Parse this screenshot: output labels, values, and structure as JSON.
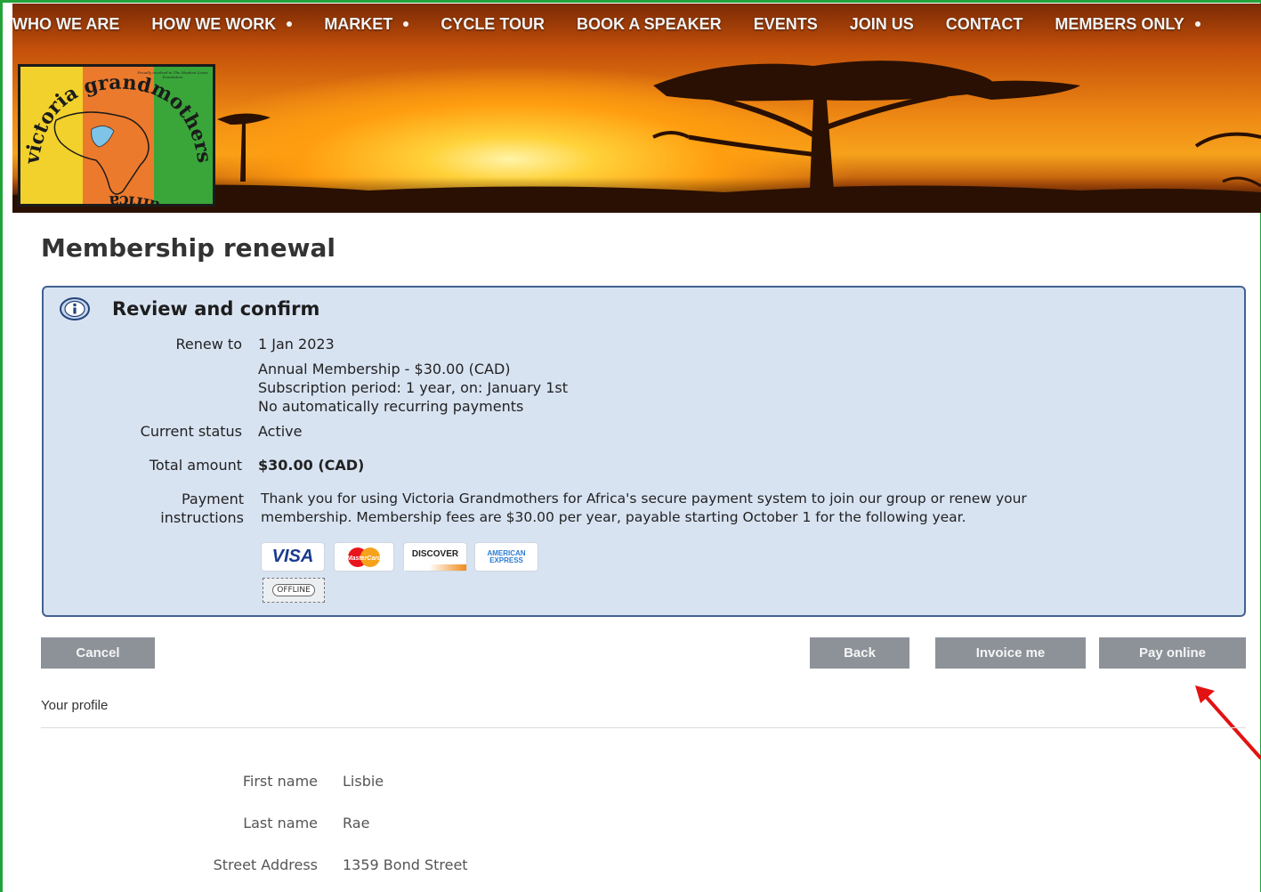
{
  "nav": {
    "items": [
      {
        "label": "WHO WE ARE",
        "dropdown": false
      },
      {
        "label": "HOW WE WORK",
        "dropdown": true
      },
      {
        "label": "MARKET",
        "dropdown": true
      },
      {
        "label": "CYCLE TOUR",
        "dropdown": false
      },
      {
        "label": "BOOK A SPEAKER",
        "dropdown": false
      },
      {
        "label": "EVENTS",
        "dropdown": false
      },
      {
        "label": "JOIN US",
        "dropdown": false
      },
      {
        "label": "CONTACT",
        "dropdown": false
      },
      {
        "label": "MEMBERS ONLY",
        "dropdown": true
      }
    ]
  },
  "logo": {
    "text_top": "victoria grandmothers",
    "text_bottom": "for africa",
    "badge": "Proudly involved in The Stephen Lewis Foundation"
  },
  "page": {
    "title": "Membership renewal"
  },
  "review": {
    "title": "Review and confirm",
    "renew_to_label": "Renew to",
    "renew_to_value": "1 Jan 2023",
    "details": [
      "Annual Membership - $30.00 (CAD)",
      "Subscription period: 1 year, on: January 1st",
      "No automatically recurring payments"
    ],
    "status_label": "Current status",
    "status_value": "Active",
    "total_label": "Total amount",
    "total_value": "$30.00 (CAD)",
    "payment_label_1": "Payment",
    "payment_label_2": "instructions",
    "payment_text_1": "Thank you for using Victoria Grandmothers for Africa's secure payment system to join our group or renew your",
    "payment_text_2": "membership. Membership fees are $30.00 per year, payable starting October 1 for the following year.",
    "cards": {
      "visa": "VISA",
      "mastercard": "MasterCard",
      "discover": "DISCOVER",
      "amex_1": "AMERICAN",
      "amex_2": "EXPRESS",
      "offline": "OFFLINE"
    }
  },
  "buttons": {
    "cancel": "Cancel",
    "back": "Back",
    "invoice": "Invoice me",
    "pay_online": "Pay online"
  },
  "profile": {
    "heading": "Your profile",
    "fields": [
      {
        "label": "First name",
        "value": "Lisbie"
      },
      {
        "label": "Last name",
        "value": "Rae"
      },
      {
        "label": "Street Address",
        "value": "1359 Bond Street"
      }
    ]
  },
  "colors": {
    "frame": "#22a33a",
    "review_bg": "#d8e3f2",
    "review_border": "#41618f",
    "button_bg": "#8d9299",
    "arrow": "#e31212"
  }
}
